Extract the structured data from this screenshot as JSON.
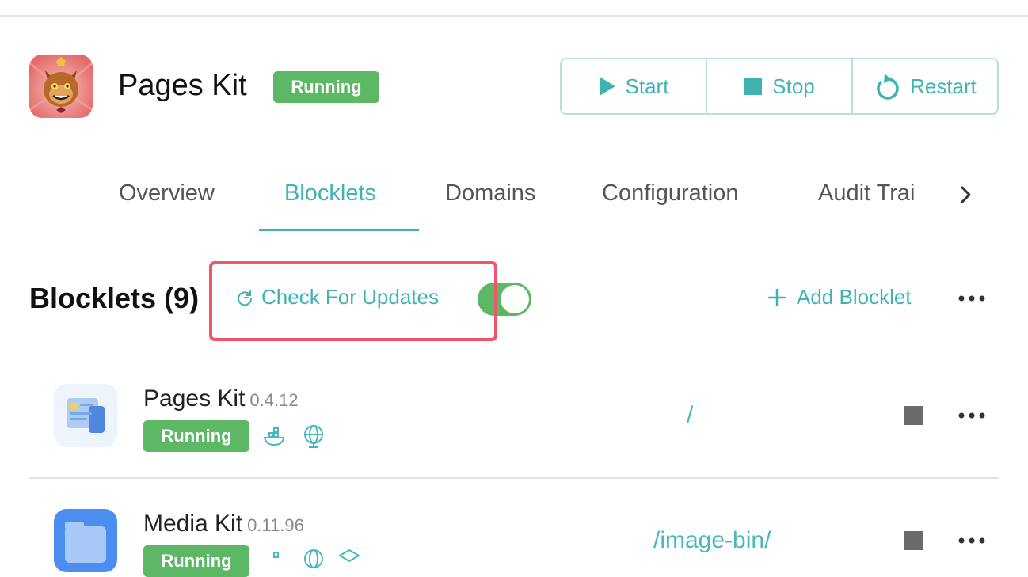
{
  "app": {
    "title": "Pages Kit",
    "status": "Running",
    "icon": "cat-avatar-icon"
  },
  "actions": [
    {
      "label": "Start",
      "icon": "play-icon"
    },
    {
      "label": "Stop",
      "icon": "stop-icon"
    },
    {
      "label": "Restart",
      "icon": "restart-icon"
    }
  ],
  "tabs": [
    {
      "label": "Overview",
      "active": false
    },
    {
      "label": "Blocklets",
      "active": true
    },
    {
      "label": "Domains",
      "active": false
    },
    {
      "label": "Configuration",
      "active": false
    },
    {
      "label": "Audit Trai",
      "active": false
    }
  ],
  "section": {
    "title": "Blocklets (9)",
    "check_updates": "Check For Updates",
    "auto_update_enabled": true,
    "add_blocklet": "Add Blocklet"
  },
  "blocklets": [
    {
      "name": "Pages Kit",
      "version": "0.4.12",
      "status": "Running",
      "path": "/",
      "icons": [
        "docker-icon",
        "globe-icon"
      ]
    },
    {
      "name": "Media Kit",
      "version": "0.11.96",
      "status": "Running",
      "path": "/image-bin/",
      "icons": [
        "docker-icon",
        "globe-icon",
        "cube-icon"
      ]
    }
  ],
  "colors": {
    "accent": "#3fb2b2",
    "running": "#5cb865",
    "highlight": "#f0566a"
  }
}
